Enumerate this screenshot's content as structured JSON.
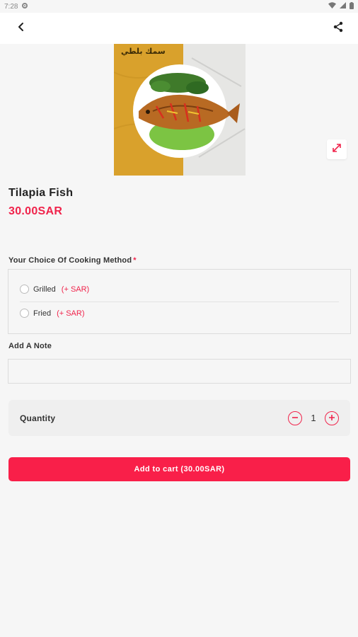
{
  "status_bar": {
    "time": "7:28",
    "icons": [
      "settings-icon",
      "wifi-icon",
      "signal-icon",
      "battery-icon"
    ]
  },
  "app_bar": {
    "back_icon": "back-arrow-icon",
    "share_icon": "share-icon"
  },
  "product": {
    "image_caption": "سمك بلطي",
    "name": "Tilapia Fish",
    "price": "30.00SAR",
    "expand_icon": "expand-icon"
  },
  "cooking_method": {
    "label": "Your Choice Of Cooking Method",
    "required_mark": "*",
    "options": [
      {
        "label": "Grilled",
        "extra": "(+ SAR)"
      },
      {
        "label": "Fried",
        "extra": "(+ SAR)"
      }
    ]
  },
  "note": {
    "label": "Add A Note",
    "value": "",
    "placeholder": ""
  },
  "quantity": {
    "label": "Quantity",
    "value": "1"
  },
  "cart": {
    "label": "Add to cart (30.00SAR)"
  },
  "colors": {
    "accent": "#f0234b",
    "background": "#f6f6f6"
  }
}
